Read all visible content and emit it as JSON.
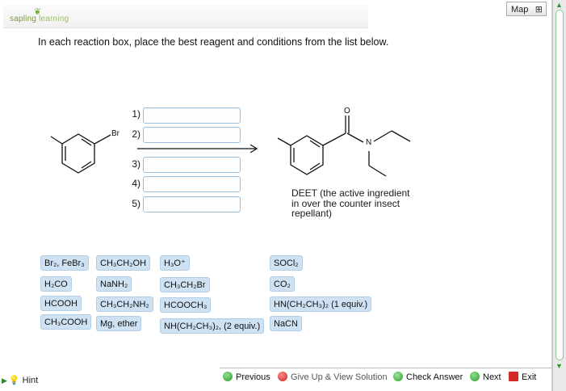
{
  "brand": {
    "name_part1": "sapling",
    "name_part2": "learning"
  },
  "toolbar": {
    "map_label": "Map",
    "map_icon": "sitemap-icon"
  },
  "instruction": "In each reaction box, place the best reagent and conditions from the list below.",
  "steps": [
    {
      "label": "1)",
      "value": ""
    },
    {
      "label": "2)",
      "value": ""
    },
    {
      "label": "3)",
      "value": ""
    },
    {
      "label": "4)",
      "value": ""
    },
    {
      "label": "5)",
      "value": ""
    }
  ],
  "reactant": {
    "substituent_label": "Br"
  },
  "product": {
    "o_label": "O",
    "n_label": "N",
    "caption_line1": "DEET (the active ingredient",
    "caption_line2": "in over the counter insect",
    "caption_line3": "repellant)"
  },
  "reagents": [
    {
      "id": "br2",
      "label": "Br₂, FeBr₃"
    },
    {
      "id": "h2co",
      "label": "H₂CO"
    },
    {
      "id": "hcooh",
      "label": "HCOOH"
    },
    {
      "id": "ch3cooh",
      "label": "CH₃COOH"
    },
    {
      "id": "ch3ch2oh",
      "label": "CH₃CH₂OH"
    },
    {
      "id": "nanh2",
      "label": "NaNH₂"
    },
    {
      "id": "ch3ch2nh2",
      "label": "CH₃CH₂NH₂"
    },
    {
      "id": "mg",
      "label": "Mg, ether"
    },
    {
      "id": "h3o",
      "label": "H₃O⁺"
    },
    {
      "id": "ch3ch2br",
      "label": "CH₃CH₂Br"
    },
    {
      "id": "hcooch3",
      "label": "HCOOCH₃"
    },
    {
      "id": "nhet2",
      "label": "NH(CH₂CH₃)₂, (2 equiv.)"
    },
    {
      "id": "socl2",
      "label": "SOCl₂"
    },
    {
      "id": "co2",
      "label": "CO₂"
    },
    {
      "id": "hnet2",
      "label": "HN(CH₂CH₃)₂ (1 equiv.)"
    },
    {
      "id": "nacn",
      "label": "NaCN"
    }
  ],
  "hint": {
    "label": "Hint",
    "icon": "lightbulb-icon"
  },
  "nav": {
    "previous": "Previous",
    "give_up": "Give Up & View Solution",
    "check": "Check Answer",
    "next": "Next",
    "exit": "Exit"
  },
  "colors": {
    "chip_bg": "#cfe2f4",
    "input_border": "#9ec0e0",
    "nav_green": "#2e9a2e",
    "exit_red": "#d42a2a"
  }
}
